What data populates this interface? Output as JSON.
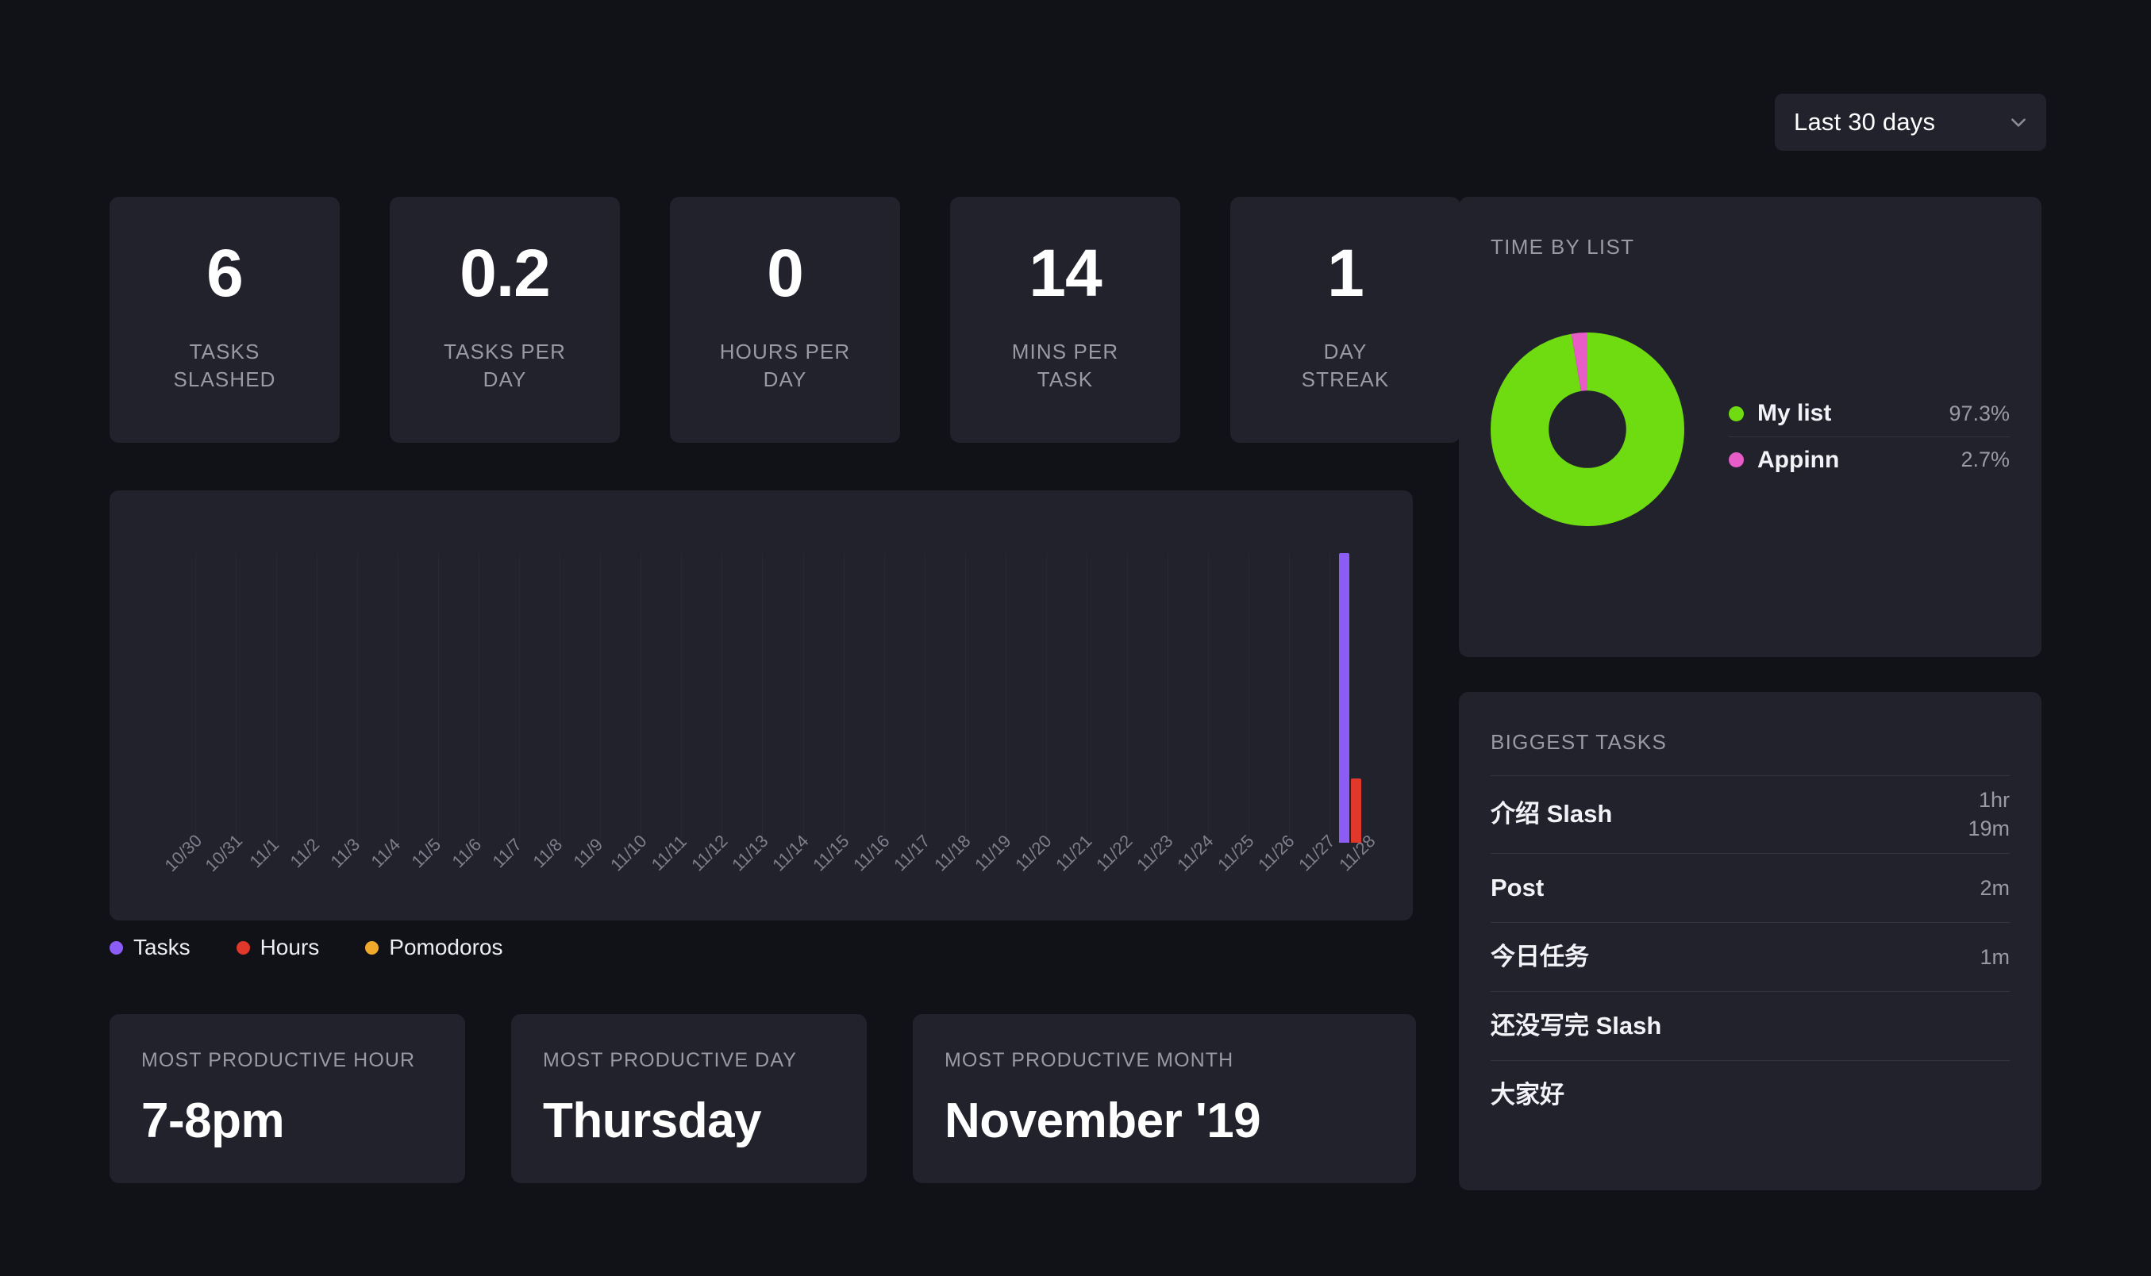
{
  "header": {
    "range_label": "Last 30 days",
    "chevron_icon": "chevron-down-icon"
  },
  "stats": [
    {
      "value": "6",
      "label": "TASKS\nSLASHED"
    },
    {
      "value": "0.2",
      "label": "TASKS PER\nDAY"
    },
    {
      "value": "0",
      "label": "HOURS PER\nDAY"
    },
    {
      "value": "14",
      "label": "MINS PER\nTASK"
    },
    {
      "value": "1",
      "label": "DAY\nSTREAK"
    }
  ],
  "legend": [
    {
      "label": "Tasks",
      "color": "#8B5CF6"
    },
    {
      "label": "Hours",
      "color": "#E0382A"
    },
    {
      "label": "Pomodoros",
      "color": "#F0A92B"
    }
  ],
  "productive": [
    {
      "label": "MOST PRODUCTIVE HOUR",
      "value": "7-8pm"
    },
    {
      "label": "MOST PRODUCTIVE DAY",
      "value": "Thursday"
    },
    {
      "label": "MOST PRODUCTIVE MONTH",
      "value": "November '19"
    }
  ],
  "time_by_list": {
    "title": "TIME BY LIST",
    "items": [
      {
        "name": "My list",
        "percent": "97.3%",
        "value": 97.3,
        "color": "#6EDC10"
      },
      {
        "name": "Appinn",
        "percent": "2.7%",
        "value": 2.7,
        "color": "#E85CC8"
      }
    ]
  },
  "biggest_tasks": {
    "title": "BIGGEST TASKS",
    "items": [
      {
        "name": "介绍 Slash",
        "duration": "1hr\n19m"
      },
      {
        "name": "Post",
        "duration": "2m"
      },
      {
        "name": "今日任务",
        "duration": "1m"
      },
      {
        "name": "还没写完 Slash",
        "duration": ""
      },
      {
        "name": "大家好",
        "duration": ""
      }
    ]
  },
  "chart_data": {
    "type": "bar",
    "title": "",
    "xlabel": "",
    "ylabel": "",
    "grid": true,
    "legend_position": "below",
    "categories": [
      "10/30",
      "10/31",
      "11/1",
      "11/2",
      "11/3",
      "11/4",
      "11/5",
      "11/6",
      "11/7",
      "11/8",
      "11/9",
      "11/10",
      "11/11",
      "11/12",
      "11/13",
      "11/14",
      "11/15",
      "11/16",
      "11/17",
      "11/18",
      "11/19",
      "11/20",
      "11/21",
      "11/22",
      "11/23",
      "11/24",
      "11/25",
      "11/26",
      "11/27",
      "11/28"
    ],
    "ylim": [
      0,
      6
    ],
    "series": [
      {
        "name": "Tasks",
        "color": "#8B5CF6",
        "values": [
          0,
          0,
          0,
          0,
          0,
          0,
          0,
          0,
          0,
          0,
          0,
          0,
          0,
          0,
          0,
          0,
          0,
          0,
          0,
          0,
          0,
          0,
          0,
          0,
          0,
          0,
          0,
          0,
          0,
          6
        ]
      },
      {
        "name": "Hours",
        "color": "#E0382A",
        "values": [
          0,
          0,
          0,
          0,
          0,
          0,
          0,
          0,
          0,
          0,
          0,
          0,
          0,
          0,
          0,
          0,
          0,
          0,
          0,
          0,
          0,
          0,
          0,
          0,
          0,
          0,
          0,
          0,
          0,
          1.33
        ]
      },
      {
        "name": "Pomodoros",
        "color": "#F0A92B",
        "values": [
          0,
          0,
          0,
          0,
          0,
          0,
          0,
          0,
          0,
          0,
          0,
          0,
          0,
          0,
          0,
          0,
          0,
          0,
          0,
          0,
          0,
          0,
          0,
          0,
          0,
          0,
          0,
          0,
          0,
          0
        ]
      }
    ]
  }
}
